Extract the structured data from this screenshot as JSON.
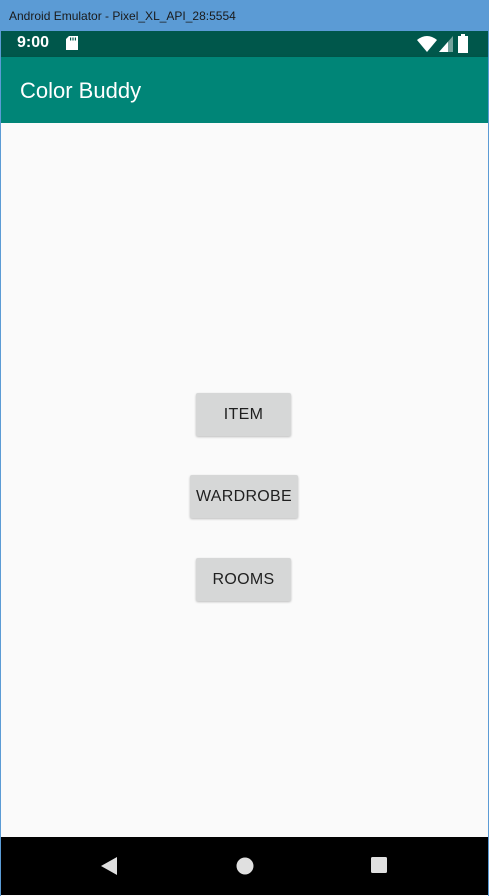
{
  "window": {
    "title": "Android Emulator - Pixel_XL_API_28:5554"
  },
  "status_bar": {
    "time": "9:00",
    "icons": [
      "sd-card-icon",
      "wifi-icon",
      "signal-icon",
      "battery-icon"
    ]
  },
  "app_bar": {
    "title": "Color Buddy"
  },
  "buttons": {
    "item_label": "ITEM",
    "wardrobe_label": "WARDROBE",
    "rooms_label": "ROOMS"
  },
  "nav_bar": {
    "icons": [
      "back-icon",
      "home-icon",
      "recents-icon"
    ]
  },
  "colors": {
    "status_bar": "#00574b",
    "app_bar": "#008577",
    "window_title_bar": "#5b9bd5",
    "button": "#d6d7d7",
    "background": "#fafafa"
  }
}
